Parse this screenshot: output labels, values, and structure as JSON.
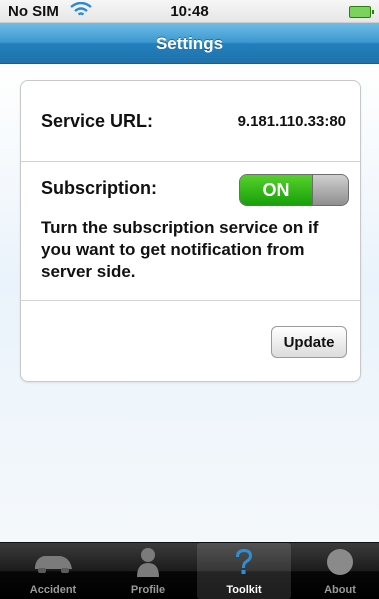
{
  "status_bar": {
    "carrier": "No SIM",
    "time": "10:48"
  },
  "nav": {
    "title": "Settings"
  },
  "settings": {
    "service_url_label": "Service URL:",
    "service_url_value": "9.181.110.33:80",
    "subscription_label": "Subscription:",
    "subscription_toggle_label": "ON",
    "subscription_enabled": true,
    "subscription_description": "Turn the subscription service on if you want to get notification from server side.",
    "update_label": "Update"
  },
  "tabs": [
    {
      "label": "Accident",
      "icon": "car-icon",
      "selected": false
    },
    {
      "label": "Profile",
      "icon": "person-icon",
      "selected": false
    },
    {
      "label": "Toolkit",
      "icon": "question-icon",
      "selected": true
    },
    {
      "label": "About",
      "icon": "circle-icon",
      "selected": false
    }
  ],
  "colors": {
    "nav_accent": "#237fbd",
    "toggle_on": "#18a00a",
    "selected_icon": "#2f8fd6"
  }
}
